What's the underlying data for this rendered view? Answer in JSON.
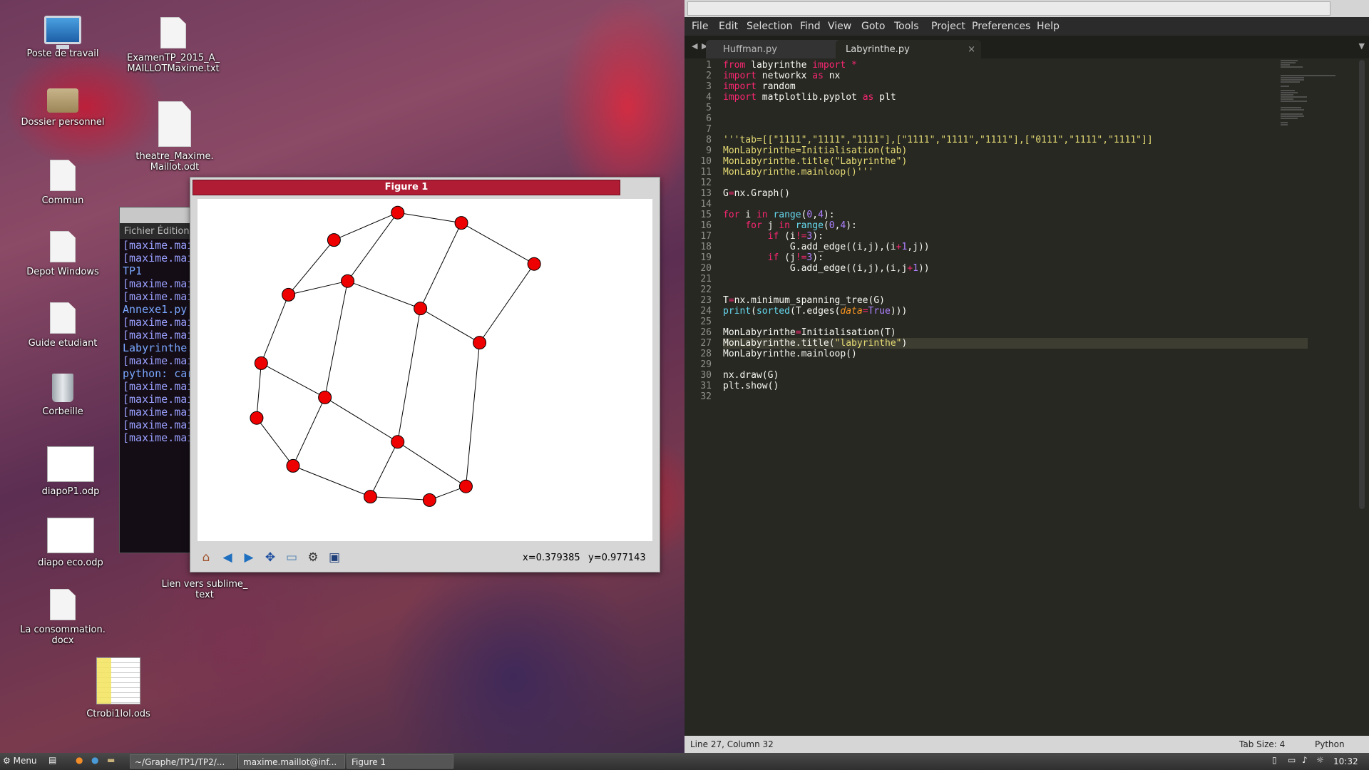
{
  "desktop": {
    "icons": [
      {
        "label": "Poste de travail"
      },
      {
        "label": "ExamenTP_2015_A_\nMAILLOTMaxime.txt"
      },
      {
        "label": "Dossier personnel"
      },
      {
        "label": "theatre_Maxime.\nMaillot.odt"
      },
      {
        "label": "Commun"
      },
      {
        "label": "Depot Windows"
      },
      {
        "label": "Guide etudiant"
      },
      {
        "label": "Corbeille"
      },
      {
        "label": "diapoP1.odp"
      },
      {
        "label": "diapo eco.odp"
      },
      {
        "label": "La consommation.\ndocx"
      },
      {
        "label": "Ctrobi1lol.ods"
      },
      {
        "label": "Lien vers sublime_\ntext"
      }
    ]
  },
  "terminal": {
    "menu": "Fichier  Édition",
    "lines": [
      "[maxime.mai",
      "[maxime.mai",
      "TP1",
      "[maxime.mai",
      "[maxime.mai",
      "Annexe1.py",
      "[maxime.mai",
      "[maxime.mai",
      "Labyrinthe.",
      "[maxime.mai",
      "python: car",
      "[maxime.mai",
      "[maxime.mai",
      "[maxime.mai",
      "[maxime.mai",
      "[maxime.mai"
    ]
  },
  "figure": {
    "title": "Figure 1",
    "coords_x": "x=0.379385",
    "coords_y": "y=0.977143",
    "toolbar": [
      "home-icon",
      "back-icon",
      "forward-icon",
      "pan-icon",
      "zoom-icon",
      "configure-icon",
      "save-icon"
    ],
    "node_color": "#ee0000"
  },
  "chart_data": {
    "type": "scatter",
    "nodes": [
      [
        0.3,
        0.88
      ],
      [
        0.44,
        0.96
      ],
      [
        0.58,
        0.93
      ],
      [
        0.74,
        0.81
      ],
      [
        0.2,
        0.72
      ],
      [
        0.33,
        0.76
      ],
      [
        0.49,
        0.68
      ],
      [
        0.62,
        0.58
      ],
      [
        0.14,
        0.52
      ],
      [
        0.28,
        0.42
      ],
      [
        0.44,
        0.29
      ],
      [
        0.59,
        0.16
      ],
      [
        0.13,
        0.36
      ],
      [
        0.21,
        0.22
      ],
      [
        0.38,
        0.13
      ],
      [
        0.51,
        0.12
      ]
    ],
    "edges": [
      [
        0,
        1
      ],
      [
        1,
        2
      ],
      [
        2,
        3
      ],
      [
        4,
        5
      ],
      [
        5,
        6
      ],
      [
        6,
        7
      ],
      [
        8,
        9
      ],
      [
        9,
        10
      ],
      [
        10,
        11
      ],
      [
        12,
        13
      ],
      [
        13,
        14
      ],
      [
        14,
        15
      ],
      [
        0,
        4
      ],
      [
        4,
        8
      ],
      [
        8,
        12
      ],
      [
        1,
        5
      ],
      [
        5,
        9
      ],
      [
        9,
        13
      ],
      [
        2,
        6
      ],
      [
        6,
        10
      ],
      [
        10,
        14
      ],
      [
        3,
        7
      ],
      [
        7,
        11
      ],
      [
        11,
        15
      ]
    ]
  },
  "sublime": {
    "menu": [
      "File",
      "Edit",
      "Selection",
      "Find",
      "View",
      "Goto",
      "Tools",
      "Project",
      "Preferences",
      "Help"
    ],
    "tabs": [
      {
        "label": "Huffman.py"
      },
      {
        "label": "Labyrinthe.py"
      }
    ],
    "status_left": "Line 27, Column 32",
    "status_tab": "Tab Size: 4",
    "status_lang": "Python",
    "current_line": 27
  },
  "taskbar": {
    "menu": "Menu",
    "tasks": [
      "~/Graphe/TP1/TP2/...",
      "maxime.maillot@inf...",
      "Figure 1"
    ],
    "clock": "10:32"
  }
}
